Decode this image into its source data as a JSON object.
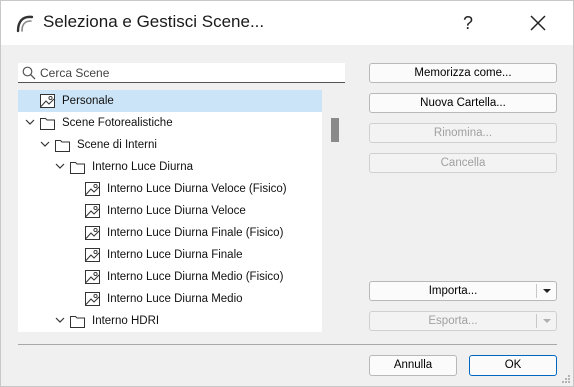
{
  "window": {
    "title": "Seleziona e Gestisci Scene...",
    "help_label": "?"
  },
  "search": {
    "placeholder": "Cerca Scene"
  },
  "tree": {
    "items": [
      {
        "label": "Personale",
        "kind": "scene",
        "level": 0,
        "selected": true
      },
      {
        "label": "Scene Fotorealistiche",
        "kind": "folder",
        "level": 0,
        "expanded": true
      },
      {
        "label": "Scene di Interni",
        "kind": "folder",
        "level": 1,
        "expanded": true
      },
      {
        "label": "Interno Luce Diurna",
        "kind": "folder",
        "level": 2,
        "expanded": true
      },
      {
        "label": "Interno Luce Diurna Veloce (Fisico)",
        "kind": "scene",
        "level": 3
      },
      {
        "label": "Interno Luce Diurna Veloce",
        "kind": "scene",
        "level": 3
      },
      {
        "label": "Interno Luce Diurna Finale (Fisico)",
        "kind": "scene",
        "level": 3
      },
      {
        "label": "Interno Luce Diurna Finale",
        "kind": "scene",
        "level": 3
      },
      {
        "label": "Interno Luce Diurna Medio (Fisico)",
        "kind": "scene",
        "level": 3
      },
      {
        "label": "Interno Luce Diurna Medio",
        "kind": "scene",
        "level": 3
      },
      {
        "label": "Interno HDRI",
        "kind": "folder",
        "level": 2,
        "expanded": true
      }
    ]
  },
  "actions": {
    "save_as": "Memorizza come...",
    "new_folder": "Nuova Cartella...",
    "rename": "Rinomina...",
    "delete": "Cancella",
    "import": "Importa...",
    "export": "Esporta..."
  },
  "footer": {
    "cancel": "Annulla",
    "ok": "OK"
  },
  "colors": {
    "selection": "#cce4f7",
    "primary_border": "#0067c0",
    "disabled_text": "#a0a0a0"
  }
}
